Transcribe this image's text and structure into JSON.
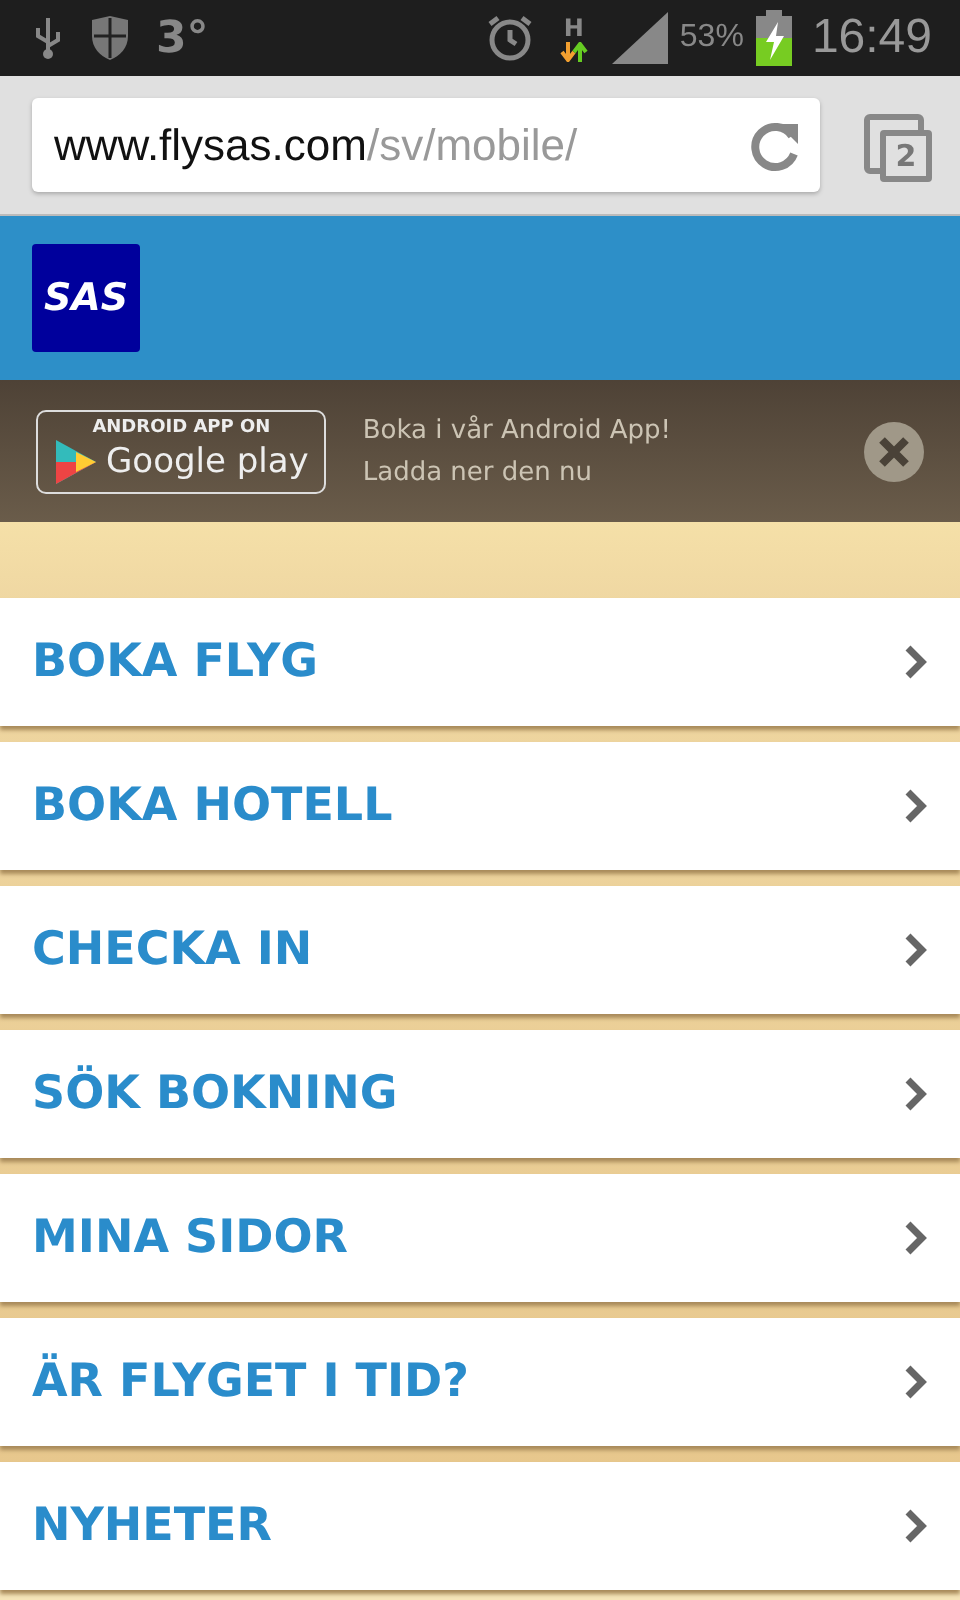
{
  "status_bar": {
    "temperature": "3°",
    "network": "H",
    "battery": "53%",
    "time": "16:49"
  },
  "browser": {
    "url_host": "www.flysas.com",
    "url_path": "/sv/mobile/",
    "tab_count": "2"
  },
  "header": {
    "logo": "SAS"
  },
  "app_banner": {
    "badge_top": "ANDROID APP ON",
    "badge_main": "Google play",
    "line_1": "Boka i vår Android App!",
    "line_2": "Ladda ner den nu"
  },
  "menu": [
    {
      "label": "BOKA FLYG"
    },
    {
      "label": "BOKA HOTELL"
    },
    {
      "label": "CHECKA IN"
    },
    {
      "label": "SÖK BOKNING"
    },
    {
      "label": "MINA SIDOR"
    },
    {
      "label": "ÄR FLYGET I TID?"
    },
    {
      "label": "NYHETER"
    }
  ]
}
